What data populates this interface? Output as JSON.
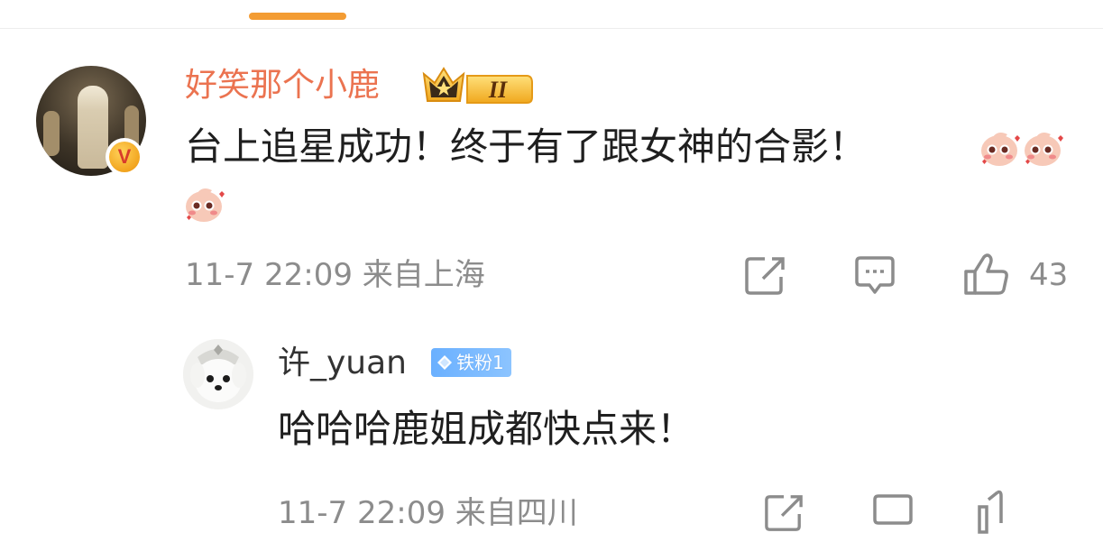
{
  "comment": {
    "username": "好笑那个小鹿",
    "badge_level": "II",
    "text": "台上追星成功！终于有了跟女神的合影！",
    "emojis": [
      "blush-emoji",
      "blush-emoji",
      "blush-emoji"
    ],
    "meta": "11-7 22:09 来自上海",
    "like_count": "43"
  },
  "reply": {
    "username": "许_yuan",
    "fan_badge": "铁粉1",
    "text": "哈哈哈鹿姐成都快点来！",
    "meta": "11-7 22:09 来自四川"
  },
  "colors": {
    "accent": "#f39c33",
    "username": "#eb7350",
    "meta": "#8c8c8c",
    "fan_badge": "#6ab0ff"
  }
}
